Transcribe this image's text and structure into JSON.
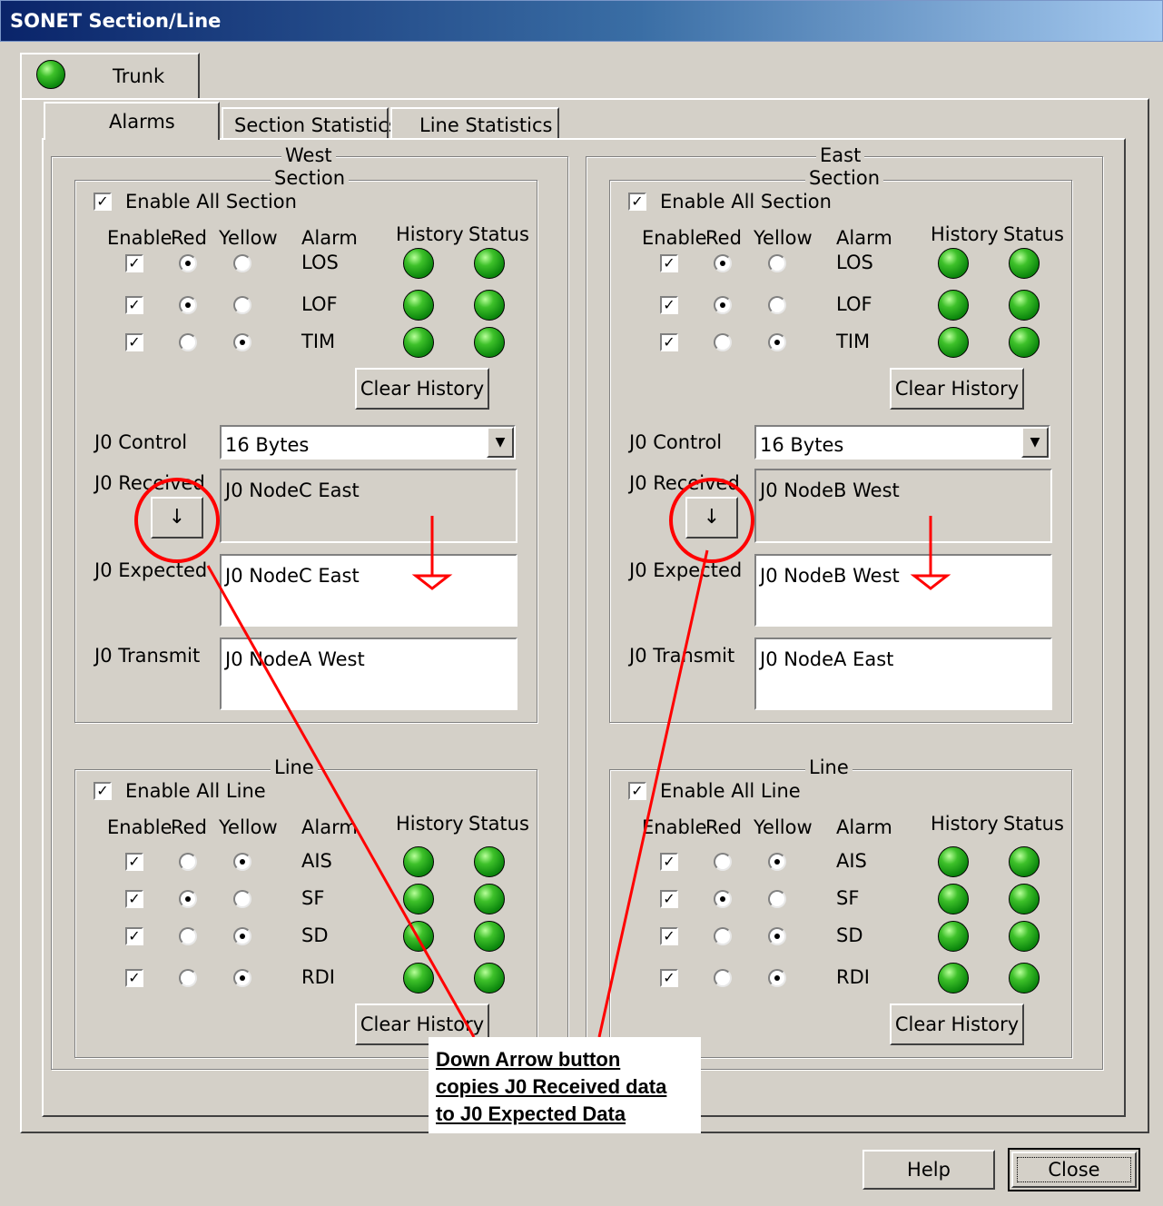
{
  "window": {
    "title": "SONET Section/Line"
  },
  "outer_tab": {
    "label": "Trunk",
    "icon": "green-led-icon"
  },
  "tabs": [
    {
      "label": "Alarms",
      "selected": true
    },
    {
      "label": "Section Statistics",
      "selected": false
    },
    {
      "label": "Line Statistics",
      "selected": false
    }
  ],
  "panels": [
    {
      "name": "West",
      "section": {
        "title": "Section",
        "enable_all_label": "Enable All Section",
        "enable_all_checked": true,
        "headers": {
          "enable": "Enable",
          "red": "Red",
          "yellow": "Yellow",
          "alarm": "Alarm",
          "history": "History",
          "status": "Status"
        },
        "rows": [
          {
            "alarm": "LOS",
            "enabled": true,
            "severity": "red"
          },
          {
            "alarm": "LOF",
            "enabled": true,
            "severity": "red"
          },
          {
            "alarm": "TIM",
            "enabled": true,
            "severity": "yellow"
          }
        ],
        "clear_history_label": "Clear History",
        "j0_control_label": "J0 Control",
        "j0_control_value": "16 Bytes",
        "j0_received_label": "J0 Received",
        "j0_received_value": "J0 NodeC East",
        "copy_button_label": "↓",
        "j0_expected_label": "J0 Expected",
        "j0_expected_value": "J0 NodeC East",
        "j0_transmit_label": "J0 Transmit",
        "j0_transmit_value": "J0 NodeA West"
      },
      "line": {
        "title": "Line",
        "enable_all_label": "Enable All Line",
        "enable_all_checked": true,
        "headers": {
          "enable": "Enable",
          "red": "Red",
          "yellow": "Yellow",
          "alarm": "Alarm",
          "history": "History",
          "status": "Status"
        },
        "rows": [
          {
            "alarm": "AIS",
            "enabled": true,
            "severity": "yellow"
          },
          {
            "alarm": "SF",
            "enabled": true,
            "severity": "red"
          },
          {
            "alarm": "SD",
            "enabled": true,
            "severity": "yellow"
          },
          {
            "alarm": "RDI",
            "enabled": true,
            "severity": "yellow"
          }
        ],
        "clear_history_label": "Clear History"
      }
    },
    {
      "name": "East",
      "section": {
        "title": "Section",
        "enable_all_label": "Enable All Section",
        "enable_all_checked": true,
        "headers": {
          "enable": "Enable",
          "red": "Red",
          "yellow": "Yellow",
          "alarm": "Alarm",
          "history": "History",
          "status": "Status"
        },
        "rows": [
          {
            "alarm": "LOS",
            "enabled": true,
            "severity": "red"
          },
          {
            "alarm": "LOF",
            "enabled": true,
            "severity": "red"
          },
          {
            "alarm": "TIM",
            "enabled": true,
            "severity": "yellow"
          }
        ],
        "clear_history_label": "Clear History",
        "j0_control_label": "J0 Control",
        "j0_control_value": "16 Bytes",
        "j0_received_label": "J0 Received",
        "j0_received_value": "J0 NodeB West",
        "copy_button_label": "↓",
        "j0_expected_label": "J0 Expected",
        "j0_expected_value": "J0 NodeB West",
        "j0_transmit_label": "J0 Transmit",
        "j0_transmit_value": "J0 NodeA East"
      },
      "line": {
        "title": "Line",
        "enable_all_label": "Enable All Line",
        "enable_all_checked": true,
        "headers": {
          "enable": "Enable",
          "red": "Red",
          "yellow": "Yellow",
          "alarm": "Alarm",
          "history": "History",
          "status": "Status"
        },
        "rows": [
          {
            "alarm": "AIS",
            "enabled": true,
            "severity": "yellow"
          },
          {
            "alarm": "SF",
            "enabled": true,
            "severity": "red"
          },
          {
            "alarm": "SD",
            "enabled": true,
            "severity": "yellow"
          },
          {
            "alarm": "RDI",
            "enabled": true,
            "severity": "yellow"
          }
        ],
        "clear_history_label": "Clear History"
      }
    }
  ],
  "annotation": {
    "lines": [
      "Down Arrow button",
      "copies J0 Received data",
      "to J0 Expected Data"
    ],
    "color": "#ff0000"
  },
  "buttons": {
    "help": "Help",
    "close": "Close"
  },
  "icons": {
    "status_led": "green-led-icon",
    "dropdown": "chevron-down-icon"
  },
  "colors": {
    "window_bg": "#d4d0c8",
    "title_bar": "#0a246a",
    "led_green": "#1ea81e",
    "annotation_red": "#ff0000"
  }
}
